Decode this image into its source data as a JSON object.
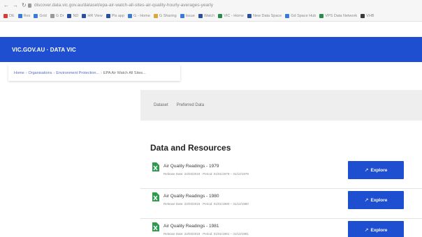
{
  "browser": {
    "url": "discover.data.vic.gov.au/dataset/epa-air-watch-all-sites-air-quality-hourly-averages-yearly",
    "bookmarks": [
      {
        "label": "DE",
        "color": "#d93b3b"
      },
      {
        "label": "Res",
        "color": "#3a7bd5"
      },
      {
        "label": "Grid",
        "color": "#3a7bd5"
      },
      {
        "label": "G Dr",
        "color": "#9a9a9a"
      },
      {
        "label": "ND",
        "color": "#2a4fa0"
      },
      {
        "label": "HR View",
        "color": "#2a4fa0"
      },
      {
        "label": "Pls app",
        "color": "#2a4fa0"
      },
      {
        "label": "G - Home",
        "color": "#3a7bd5"
      },
      {
        "label": "G Sharing",
        "color": "#d9a93b"
      },
      {
        "label": "Issue",
        "color": "#3a7bd5"
      },
      {
        "label": "Watch",
        "color": "#2a4fa0"
      },
      {
        "label": "VIC - Home",
        "color": "#2a8a4a"
      },
      {
        "label": "New Data Space",
        "color": "#2a4fa0"
      },
      {
        "label": "Gd Space Hub",
        "color": "#3a7bd5"
      },
      {
        "label": "VPS Data Network",
        "color": "#2a8a4a"
      },
      {
        "label": "VHB",
        "color": "#3a3a3a"
      }
    ]
  },
  "site": {
    "brand": "VIC.GOV.AU · DATA VIC"
  },
  "breadcrumb": {
    "items": [
      "Home",
      "Organisations",
      "Environment Protection..."
    ],
    "current": "EPA Air Watch All Sites..."
  },
  "tabs": [
    "Dataset",
    "Preferred Data"
  ],
  "resources": {
    "title": "Data and Resources",
    "explore_label": "Explore",
    "items": [
      {
        "title": "Air Quality Readings - 1979",
        "meta": "Release Date: 22/03/2019 · Period: 01/01/1979 – 31/12/1979"
      },
      {
        "title": "Air Quality Readings - 1980",
        "meta": "Release Date: 22/03/2019 · Period: 01/01/1980 – 31/12/1980"
      },
      {
        "title": "Air Quality Readings - 1981",
        "meta": "Release Date: 22/03/2019 · Period: 01/01/1981 – 31/12/1981"
      }
    ]
  },
  "colors": {
    "brand_blue": "#1d4fd0",
    "csv_green": "#2e9a4e"
  }
}
